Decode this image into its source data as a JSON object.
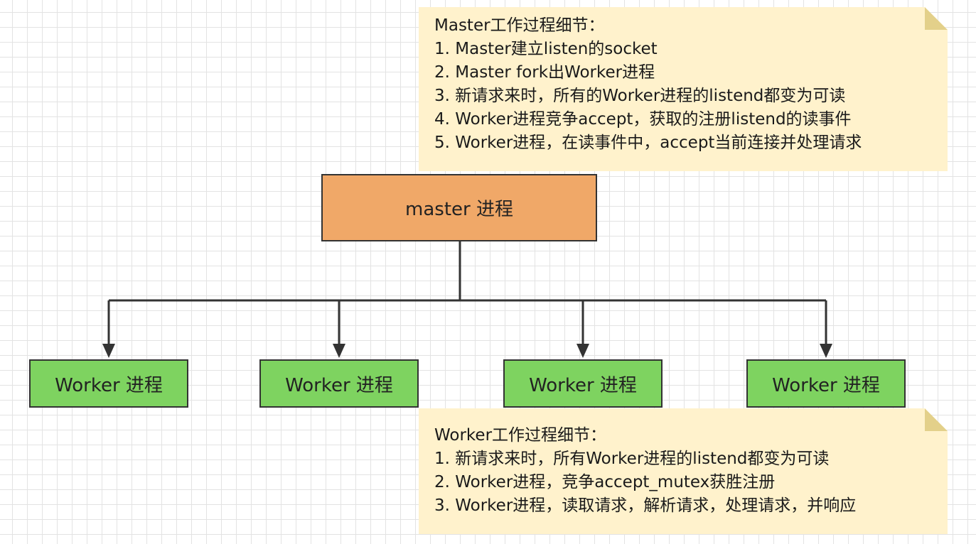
{
  "master_note": {
    "lines": [
      "Master工作过程细节：",
      "1. Master建立listen的socket",
      "2. Master fork出Worker进程",
      "3. 新请求来时，所有的Worker进程的listend都变为可读",
      "4. Worker进程竞争accept，获取的注册listend的读事件",
      "5. Worker进程，在读事件中，accept当前连接并处理请求"
    ]
  },
  "master_box": {
    "label": "master 进程"
  },
  "workers": [
    {
      "label": "Worker 进程"
    },
    {
      "label": "Worker 进程"
    },
    {
      "label": "Worker 进程"
    },
    {
      "label": "Worker 进程"
    }
  ],
  "worker_note": {
    "lines": [
      "Worker工作过程细节：",
      "1. 新请求来时，所有Worker进程的listend都变为可读",
      "2. Worker进程，竞争accept_mutex获胜注册",
      "3. Worker进程，读取请求，解析请求，处理请求，并响应"
    ]
  },
  "colors": {
    "master_fill": "#f0a868",
    "worker_fill": "#7ed360",
    "note_fill": "#fff2cc",
    "stroke": "#333333"
  }
}
